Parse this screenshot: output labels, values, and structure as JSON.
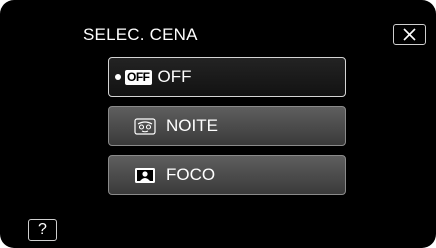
{
  "header": {
    "title": "SELEC. CENA"
  },
  "options": [
    {
      "badge": "OFF",
      "label": "OFF",
      "icon": "off-badge-icon",
      "selected": true
    },
    {
      "label": "NOITE",
      "icon": "night-face-icon",
      "selected": false
    },
    {
      "label": "FOCO",
      "icon": "spotlight-portrait-icon",
      "selected": false
    }
  ],
  "help": {
    "label": "?"
  },
  "close": {
    "icon": "close-icon"
  },
  "colors": {
    "background": "#000000",
    "button_top": "#5e5e5e",
    "button_bottom": "#3a3a3a",
    "selected_top": "#232323",
    "text": "#ffffff"
  }
}
